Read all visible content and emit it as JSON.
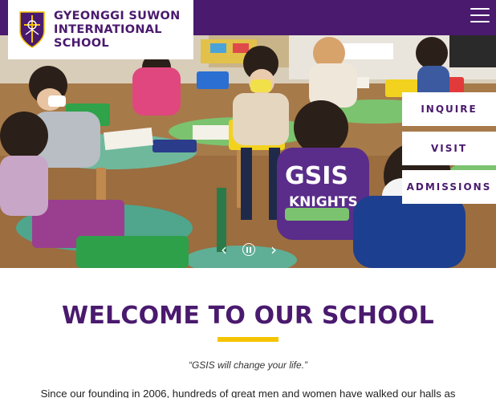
{
  "header": {
    "school_name_line1": "GYEONGGI SUWON",
    "school_name_line2": "INTERNATIONAL",
    "school_name_line3": "SCHOOL"
  },
  "hero": {
    "shirt_text_line1": "GSIS",
    "shirt_text_line2": "KNIGHTS"
  },
  "side_actions": {
    "inquire": "INQUIRE",
    "visit": "VISIT",
    "admissions": "ADMISSIONS"
  },
  "slider": {
    "prev": "‹",
    "next": "›"
  },
  "welcome": {
    "title": "WELCOME TO OUR SCHOOL",
    "quote": "“GSIS will change your life.”",
    "intro": "Since our founding in 2006, hundreds of great men and women have walked our halls as"
  },
  "colors": {
    "brand_purple": "#4a1a6e",
    "accent_yellow": "#f5c400"
  },
  "icons": {
    "menu": "hamburger-menu-icon",
    "crest": "school-crest-logo",
    "pause": "pause-icon"
  }
}
